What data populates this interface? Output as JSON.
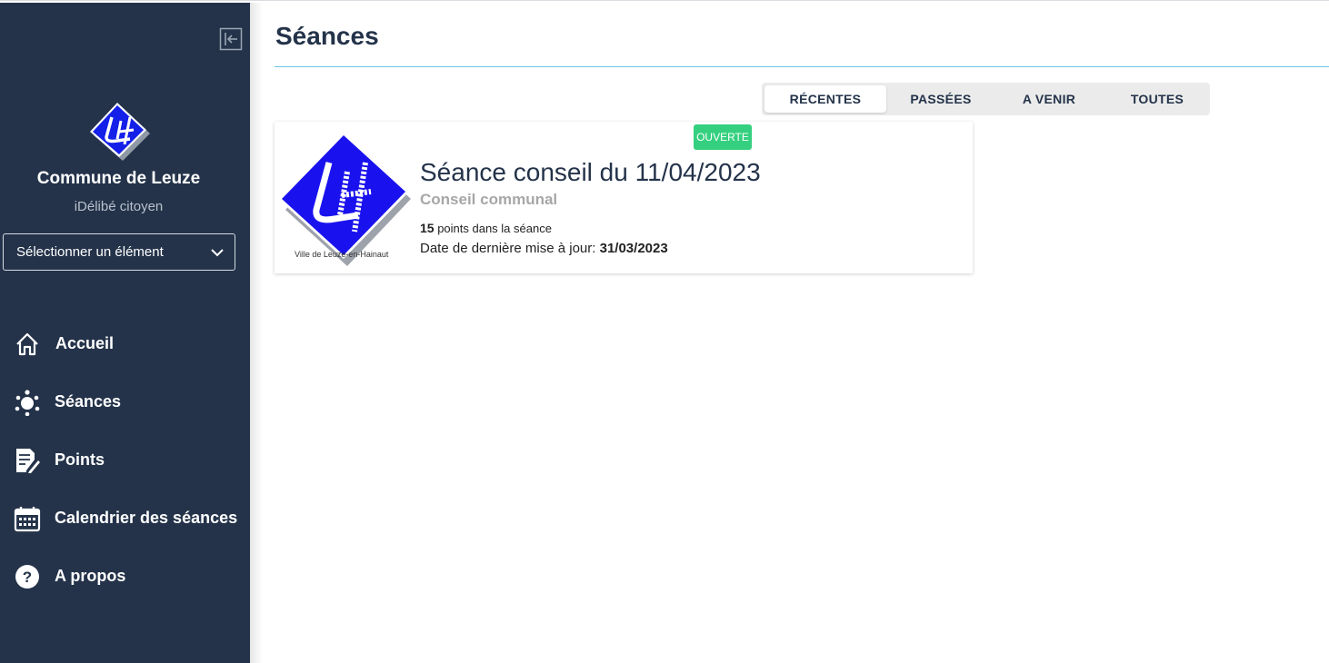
{
  "sidebar": {
    "commune_name": "Commune de Leuze",
    "app_subtitle": "iDélibé citoyen",
    "select_label": "Sélectionner un élément",
    "items": [
      {
        "label": "Accueil",
        "icon": "home-icon"
      },
      {
        "label": "Séances",
        "icon": "meeting-icon"
      },
      {
        "label": "Points",
        "icon": "document-edit-icon"
      },
      {
        "label": "Calendrier des séances",
        "icon": "calendar-icon"
      },
      {
        "label": "A propos",
        "icon": "help-icon"
      }
    ],
    "colors": {
      "background": "#24334a"
    }
  },
  "main": {
    "title": "Séances",
    "tabs": [
      {
        "label": "RÉCENTES",
        "active": true
      },
      {
        "label": "PASSÉES",
        "active": false
      },
      {
        "label": "A VENIR",
        "active": false
      },
      {
        "label": "TOUTES",
        "active": false
      }
    ],
    "seance_card": {
      "badge": "OUVERTE",
      "title": "Séance conseil du 11/04/2023",
      "subtitle": "Conseil communal",
      "points_count": "15",
      "points_text": " points dans la séance",
      "update_label": "Date de dernière mise à jour: ",
      "update_date": "31/03/2023",
      "logo_caption": "Ville de Leuze-en-Hainaut"
    },
    "colors": {
      "accent_rule": "#6ec6e6",
      "badge": "#35d07f",
      "title": "#24334a"
    }
  }
}
